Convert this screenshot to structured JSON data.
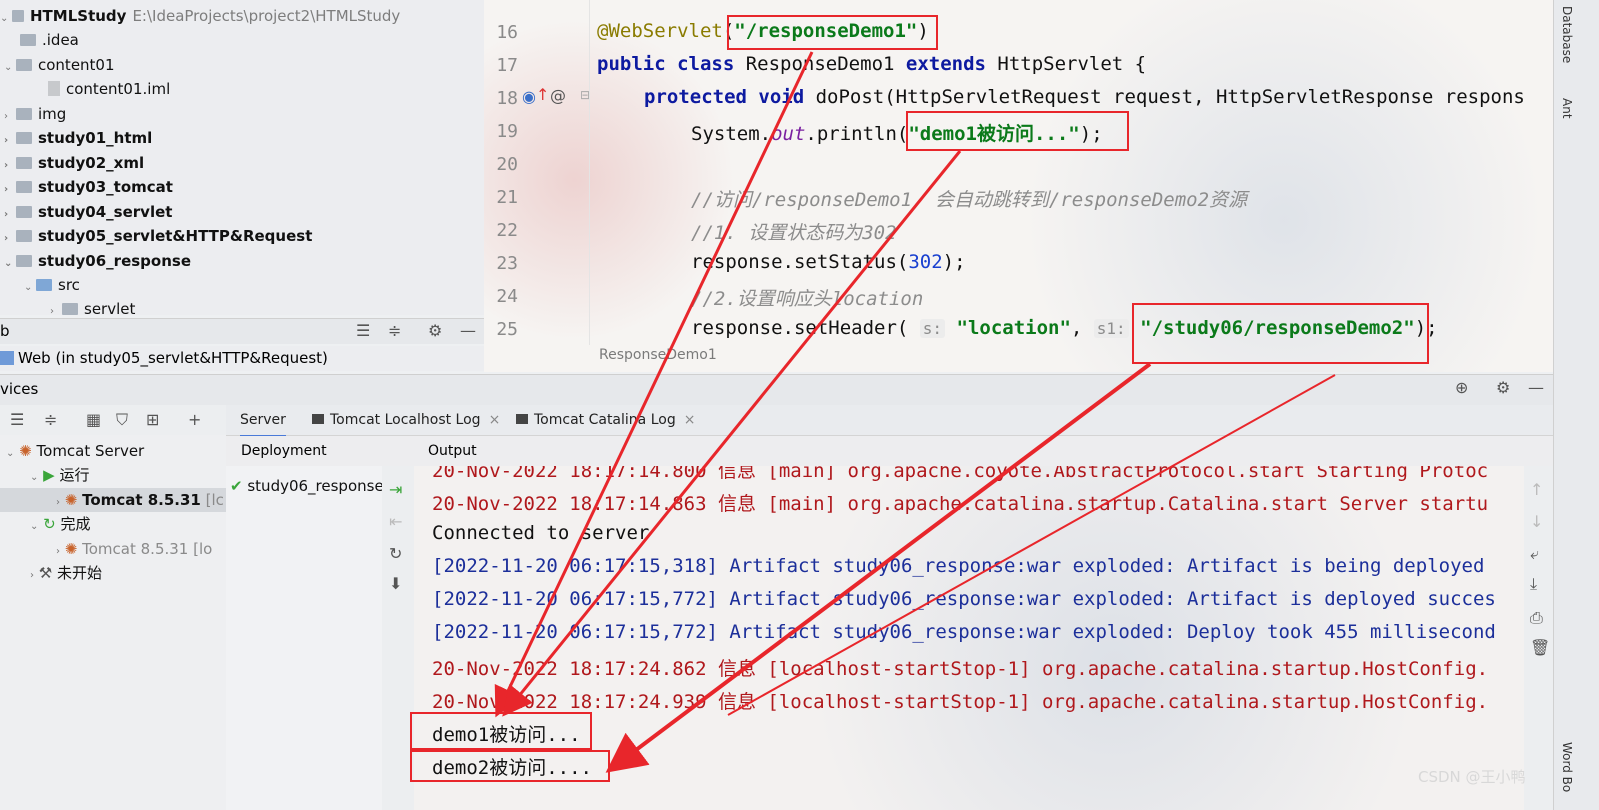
{
  "project": {
    "root_name": "HTMLStudy",
    "root_path": "E:\\IdeaProjects\\project2\\HTMLStudy",
    "items": [
      {
        "label": ".idea",
        "bold": false
      },
      {
        "label": "content01",
        "bold": false
      },
      {
        "label": "content01.iml",
        "bold": false
      },
      {
        "label": "img",
        "bold": false
      },
      {
        "label": "study01_html",
        "bold": true
      },
      {
        "label": "study02_xml",
        "bold": true
      },
      {
        "label": "study03_tomcat",
        "bold": true
      },
      {
        "label": "study04_servlet",
        "bold": true
      },
      {
        "label": "study05_servlet&HTTP&Request",
        "bold": true
      },
      {
        "label": "study06_response",
        "bold": true
      },
      {
        "label": "src",
        "bold": false
      },
      {
        "label": "servlet",
        "bold": false
      }
    ],
    "toolbar_label": "b",
    "web_row": "Web (in study05_servlet&HTTP&Request)"
  },
  "editor": {
    "line_numbers": [
      "16",
      "17",
      "18",
      "19",
      "20",
      "21",
      "22",
      "23",
      "24",
      "25"
    ],
    "lines": {
      "l16_annotation": "@WebServlet",
      "l16_open": "(",
      "l16_value": "\"/responseDemo1\"",
      "l16_close": ")",
      "l17_public": "public",
      "l17_class": "class",
      "l17_name": " ResponseDemo1 ",
      "l17_extends": "extends",
      "l17_rest": " HttpServlet {",
      "l18_protected": "protected",
      "l18_void": "void",
      "l18_rest": " doPost(HttpServletRequest request, HttpServletResponse respons",
      "l19_prefix": "System.",
      "l19_out": "out",
      "l19_mid": ".println(",
      "l19_str": "\"demo1被访问...\"",
      "l19_end": ");",
      "l21_comment": "//访问/responseDemo1, 会自动跳转到/responseDemo2资源",
      "l22_comment": "//1. 设置状态码为302",
      "l23_prefix": "response.setStatus(",
      "l23_num": "302",
      "l23_end": ");",
      "l24_comment": "//2.设置响应头location",
      "l25_prefix": "response.setHeader( ",
      "l25_hint1": "s:",
      "l25_str1": "\"location\"",
      "l25_sep": ", ",
      "l25_hint2": "s1:",
      "l25_str2": "\"/study06/responseDemo2\"",
      "l25_end": ");"
    },
    "breadcrumb": "ResponseDemo1"
  },
  "right_stripe": {
    "top_label": "Database",
    "mid_label": "Ant",
    "bottom_label": "Word Bo"
  },
  "services": {
    "header_label": "vices",
    "tree": {
      "server": "Tomcat Server",
      "running": "运行",
      "tomcat_running": "Tomcat 8.5.31",
      "tomcat_running_suffix": "[lc",
      "finished": "完成",
      "tomcat_finished": "Tomcat 8.5.31",
      "tomcat_finished_suffix": "[lo",
      "not_started": "未开始"
    },
    "tabs": {
      "server": "Server",
      "localhost_log": "Tomcat Localhost Log",
      "catalina_log": "Tomcat Catalina Log"
    },
    "deployment_header": "Deployment",
    "output_header": "Output",
    "deployment_item": "study06_response",
    "log_lines": [
      {
        "text": "20-Nov-2022 18:17:14.800 信息 [main] org.apache.coyote.AbstractProtocol.start Starting Protoc",
        "color": "red"
      },
      {
        "text": "20-Nov-2022 18:17:14.863 信息 [main] org.apache.catalina.startup.Catalina.start Server startu",
        "color": "red"
      },
      {
        "text": "Connected to server",
        "color": "black"
      },
      {
        "text": "[2022-11-20 06:17:15,318] Artifact study06_response:war exploded: Artifact is being deployed",
        "color": "blue"
      },
      {
        "text": "[2022-11-20 06:17:15,772] Artifact study06_response:war exploded: Artifact is deployed succes",
        "color": "blue"
      },
      {
        "text": "[2022-11-20 06:17:15,772] Artifact study06_response:war exploded: Deploy took 455 millisecond",
        "color": "blue"
      },
      {
        "text": "20-Nov-2022 18:17:24.862 信息 [localhost-startStop-1] org.apache.catalina.startup.HostConfig.",
        "color": "red"
      },
      {
        "text": "20-Nov-2022 18:17:24.939 信息 [localhost-startStop-1] org.apache.catalina.startup.HostConfig.",
        "color": "red"
      },
      {
        "text": "demo1被访问...",
        "color": "black"
      },
      {
        "text": "demo2被访问....",
        "color": "black"
      }
    ]
  },
  "watermark": "CSDN @王小鸭",
  "colors": {
    "highlight_box": "#e8262b",
    "keyword": "#0d1aa0",
    "string": "#0b7a1a",
    "log_red": "#b0181c",
    "log_blue": "#1c2f9a"
  }
}
